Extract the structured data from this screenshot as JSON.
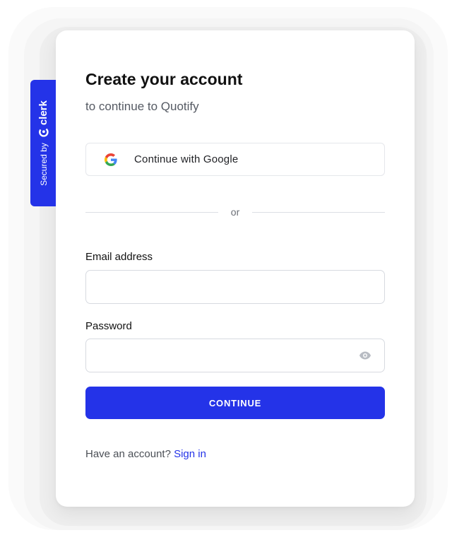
{
  "badge": {
    "secured_label": "Secured by",
    "brand": "clerk",
    "icon": "clerk-logo-icon"
  },
  "header": {
    "title": "Create your account",
    "subtitle": "to continue to Quotify"
  },
  "social": {
    "google_label": "Continue with Google",
    "icon": "google-icon"
  },
  "divider": {
    "text": "or"
  },
  "form": {
    "email_label": "Email address",
    "email_value": "",
    "password_label": "Password",
    "password_value": "",
    "password_toggle_icon": "eye-icon",
    "submit_label": "CONTINUE"
  },
  "footer": {
    "prompt": "Have an account?",
    "link": "Sign in"
  },
  "colors": {
    "accent": "#2433e8",
    "text": "#111111",
    "muted": "#555a63",
    "border": "#d7dae0"
  }
}
